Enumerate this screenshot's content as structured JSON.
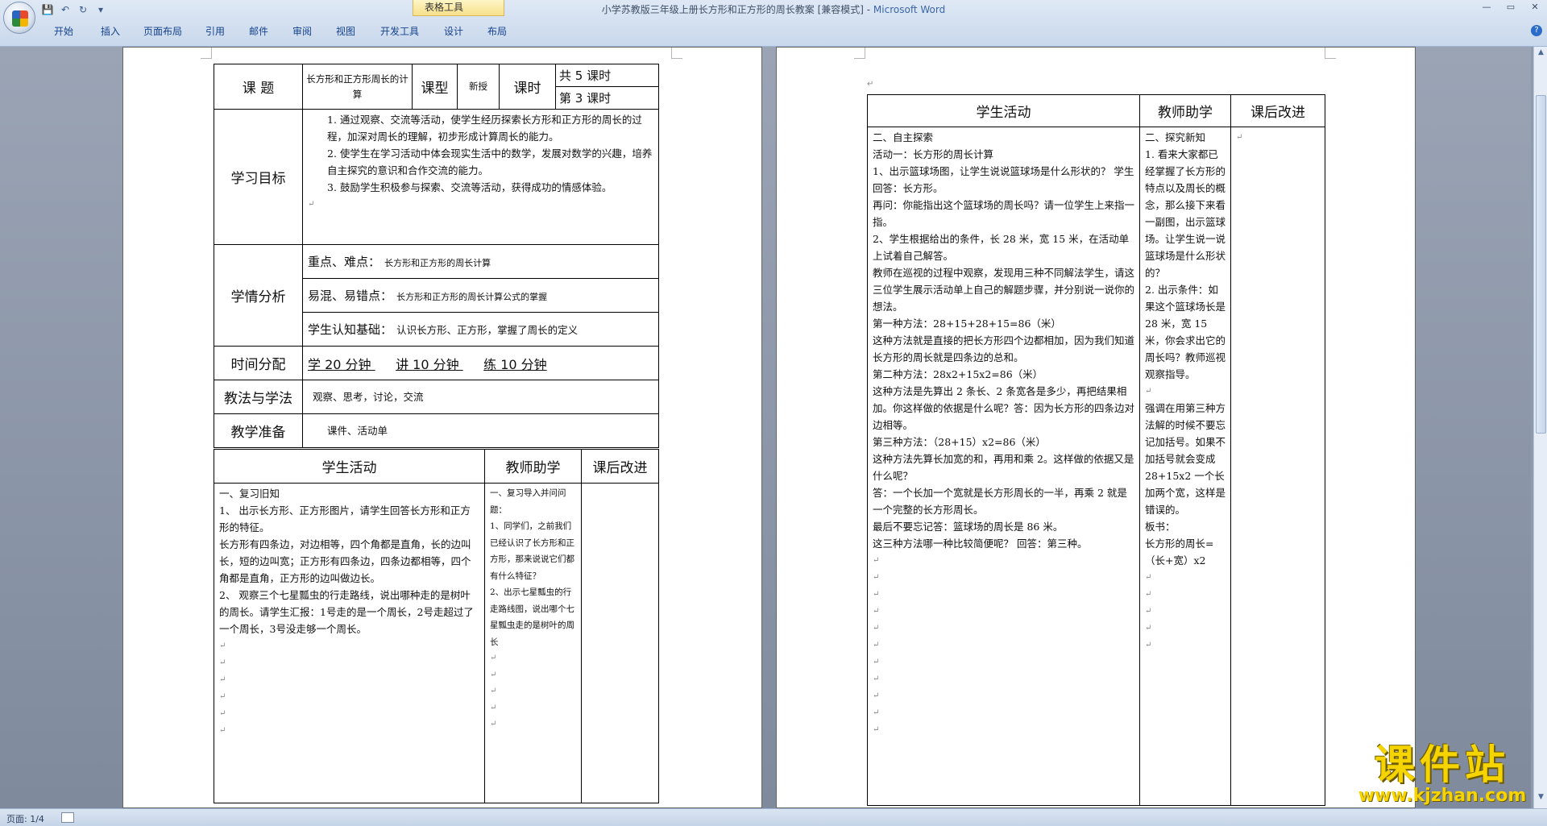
{
  "window": {
    "title": "小学苏教版三年级上册长方形和正方形的周长教案 [兼容模式] - ",
    "app": "Microsoft Word",
    "context_tab_group": "表格工具",
    "controls": [
      "—",
      "▭",
      "✕"
    ]
  },
  "qat": {
    "save": "💾",
    "undo": "↶",
    "redo": "↻",
    "more": "▾"
  },
  "tabs": [
    {
      "label": "开始",
      "w": 62
    },
    {
      "label": "插入",
      "w": 54
    },
    {
      "label": "页面布局",
      "w": 76
    },
    {
      "label": "引用",
      "w": 54
    },
    {
      "label": "邮件",
      "w": 54
    },
    {
      "label": "审阅",
      "w": 54
    },
    {
      "label": "视图",
      "w": 54
    },
    {
      "label": "开发工具",
      "w": 80
    },
    {
      "label": "设计",
      "w": 54
    },
    {
      "label": "布局",
      "w": 54
    }
  ],
  "help": "?",
  "mark": "↵",
  "page1": {
    "lesson_label": "课  题",
    "lesson_title": "长方形和正方形周长的计算",
    "type_label": "课型",
    "type_value": "新授",
    "hours_label": "课时",
    "hours_total": "共 5 课时",
    "hours_current": "第 3 课时",
    "goals_label": "学习目标",
    "goals": [
      "1. 通过观察、交流等活动，使学生经历探索长方形和正方形的周长的过程，加深对周长的理解，初步形成计算周长的能力。",
      "2. 使学生在学习活动中体会现实生活中的数学，发展对数学的兴趣，培养自主探究的意识和合作交流的能力。",
      "3. 鼓励学生积极参与探索、交流等活动，获得成功的情感体验。"
    ],
    "analysis_label": "学情分析",
    "key_label": "重点、难点：",
    "key_value": "长方形和正方形的周长计算",
    "confuse_label": "易混、易错点：",
    "confuse_value": "长方形和正方形的周长计算公式的掌握",
    "basis_label": "学生认知基础：",
    "basis_value": "认识长方形、正方形，掌握了周长的定义",
    "time_label": "时间分配",
    "time_learn": "学  20 分钟 ",
    "time_talk": "讲  10 分钟 ",
    "time_practice": "练 10 分钟 ",
    "method_label": "教法与学法",
    "method_value": "观察、思考，讨论，交流",
    "prep_label": "教学准备",
    "prep_value": "课件、活动单",
    "col_student": "学生活动",
    "col_teacher": "教师助学",
    "col_after": "课后改进",
    "student_lines": [
      "一、复习旧知",
      "1、 出示长方形、正方形图片，请学生回答长方形和正方形的特征。",
      "长方形有四条边，对边相等，四个角都是直角，长的边叫长，短的边叫宽；正方形有四条边，四条边都相等，四个角都是直角，正方形的边叫做边长。",
      "2、 观察三个七星瓢虫的行走路线，说出哪种走的是树叶的周长。请学生汇报：1号走的是一个周长，2号走超过了一个周长，3号没走够一个周长。"
    ],
    "teacher_lines": [
      "一、复习导入并问问题：",
      "1、同学们，之前我们已经认识了长方形和正方形，那来说说它们都有什么特征？",
      "2、出示七星瓢虫的行走路线图，说出哪个七星瓢虫走的是树叶的周长"
    ]
  },
  "page2": {
    "col_student": "学生活动",
    "col_teacher": "教师助学",
    "col_after": "课后改进",
    "student_lines": [
      "二、自主探索",
      "活动一：长方形的周长计算",
      "1、出示篮球场图，让学生说说篮球场是什么形状的？  学生回答：长方形。",
      "再问：你能指出这个篮球场的周长吗？请一位学生上来指一指。",
      "2、学生根据给出的条件，长 28 米，宽 15 米，在活动单上试着自己解答。",
      "教师在巡视的过程中观察，发现用三种不同解法学生，请这三位学生展示活动单上自己的解题步骤，并分别说一说你的想法。",
      "第一种方法：28+15+28+15=86（米）",
      "这种方法就是直接的把长方形四个边都相加，因为我们知道长方形的周长就是四条边的总和。",
      "第二种方法：28x2+15x2=86（米）",
      "这种方法是先算出 2 条长、2 条宽各是多少，再把结果相加。你这样做的依据是什么呢？答：因为长方形的四条边对边相等。",
      "第三种方法：（28+15）x2=86（米）",
      "这种方法先算长加宽的和，再用和乘 2。这样做的依据又是什么呢？",
      "答：一个长加一个宽就是长方形周长的一半，再乘 2 就是一个完整的长方形周长。",
      "最后不要忘记答：篮球场的周长是 86 米。",
      "这三种方法哪一种比较简便呢？     回答：第三种。"
    ],
    "teacher_lines": [
      "二、探究新知",
      "1. 看来大家都已经掌握了长方形的特点以及周长的概念，那么接下来看一副图，出示篮球场。让学生说一说篮球场是什么形状的？",
      "2. 出示条件：如果这个篮球场长是 28 米，宽 15 米，你会求出它的周长吗？教师巡视观察指导。",
      "",
      "强调在用第三种方法解的时候不要忘记加括号。如果不加括号就会变成 28+15x2  一个长加两个宽，这样是错误的。",
      "板书：",
      "长方形的周长=（长+宽）x2"
    ]
  },
  "status": {
    "page": "页面: 1/4"
  },
  "watermark": {
    "text": "课件站",
    "url": "www.kjzhan.com"
  }
}
